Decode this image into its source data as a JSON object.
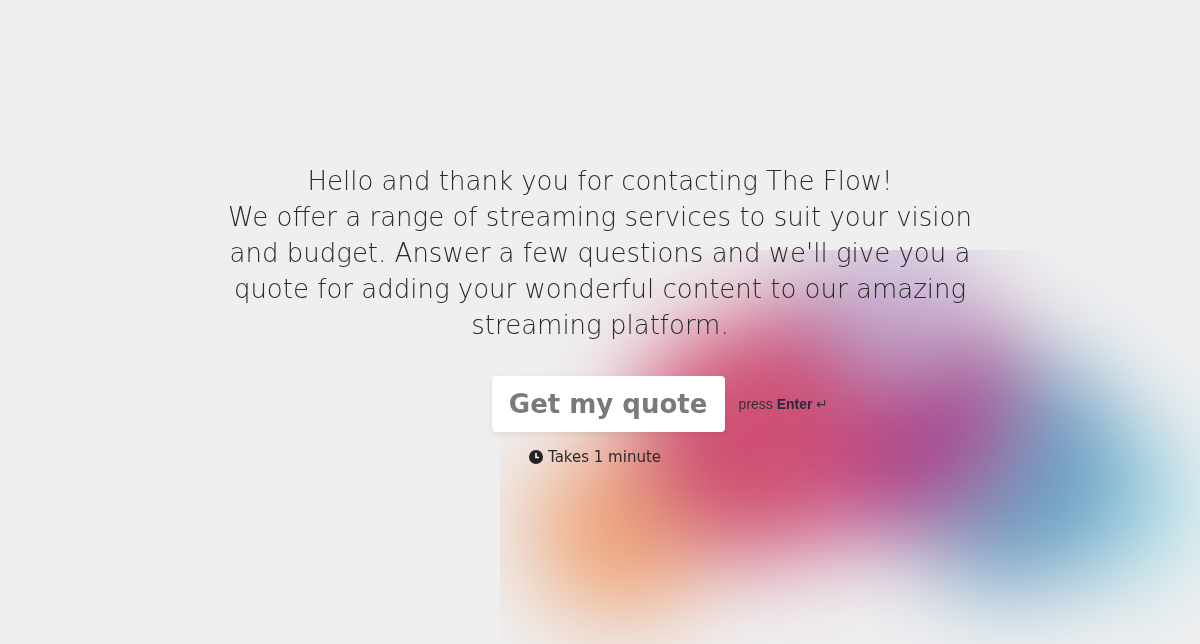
{
  "intro": {
    "greeting": "Hello and thank you for contacting The Flow!",
    "message": "We offer a range of streaming services to suit your vision and budget. Answer a few questions and we'll give you a quote for adding your wonderful content to our amazing streaming platform."
  },
  "cta": {
    "button": "Get my quote",
    "hint": "press **Enter** ↵",
    "duration": "Takes 1 minute"
  }
}
